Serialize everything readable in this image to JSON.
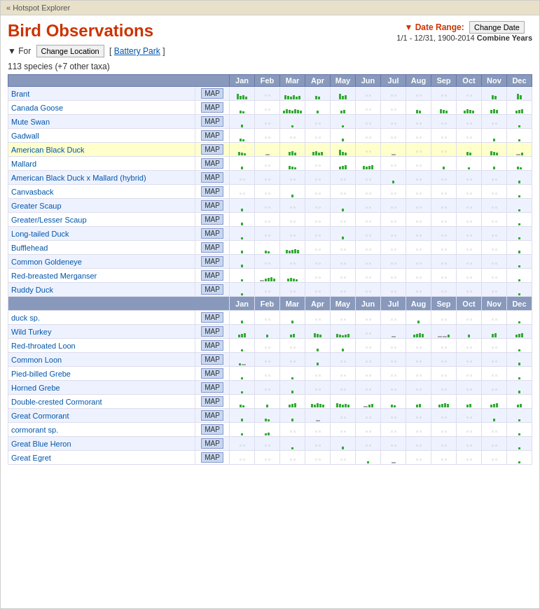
{
  "topbar": {
    "back_label": "« Hotspot Explorer"
  },
  "header": {
    "title": "Bird Observations",
    "date_range_label": "▼ Date Range:",
    "change_date_label": "Change Date",
    "date_value": "1/1 - 12/31, 1900-2014",
    "combine_label": "Combine Years",
    "for_label": "▼ For",
    "change_location_label": "Change Location",
    "location": "Battery Park"
  },
  "species_count": "113 species (+7 other taxa)",
  "months": [
    "Jan",
    "Feb",
    "Mar",
    "Apr",
    "May",
    "Jun",
    "Jul",
    "Aug",
    "Sep",
    "Oct",
    "Nov",
    "Dec"
  ],
  "species": [
    {
      "name": "Brant",
      "highlight": false
    },
    {
      "name": "Canada Goose",
      "highlight": false
    },
    {
      "name": "Mute Swan",
      "highlight": false
    },
    {
      "name": "Gadwall",
      "highlight": false
    },
    {
      "name": "American Black Duck",
      "highlight": true
    },
    {
      "name": "Mallard",
      "highlight": false
    },
    {
      "name": "American Black Duck x Mallard (hybrid)",
      "highlight": false
    },
    {
      "name": "Canvasback",
      "highlight": false
    },
    {
      "name": "Greater Scaup",
      "highlight": false
    },
    {
      "name": "Greater/Lesser Scaup",
      "highlight": false
    },
    {
      "name": "Long-tailed Duck",
      "highlight": false
    },
    {
      "name": "Bufflehead",
      "highlight": false
    },
    {
      "name": "Common Goldeneye",
      "highlight": false
    },
    {
      "name": "Red-breasted Merganser",
      "highlight": false
    },
    {
      "name": "Ruddy Duck",
      "highlight": false
    },
    {
      "name": "duck sp.",
      "highlight": false
    },
    {
      "name": "Wild Turkey",
      "highlight": false
    },
    {
      "name": "Red-throated Loon",
      "highlight": false
    },
    {
      "name": "Common Loon",
      "highlight": false
    },
    {
      "name": "Pied-billed Grebe",
      "highlight": false
    },
    {
      "name": "Horned Grebe",
      "highlight": false
    },
    {
      "name": "Double-crested Cormorant",
      "highlight": false
    },
    {
      "name": "Great Cormorant",
      "highlight": false
    },
    {
      "name": "cormorant sp.",
      "highlight": false
    },
    {
      "name": "Great Blue Heron",
      "highlight": false
    },
    {
      "name": "Great Egret",
      "highlight": false
    }
  ]
}
